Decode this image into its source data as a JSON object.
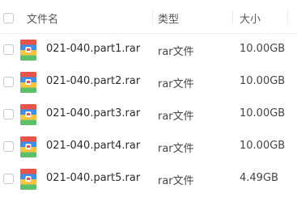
{
  "header": {
    "name_label": "文件名",
    "type_label": "类型",
    "size_label": "大小"
  },
  "files": [
    {
      "name": "021-040.part1.rar",
      "type": "rar文件",
      "size": "10.00GB",
      "icon": "rar-archive-icon"
    },
    {
      "name": "021-040.part2.rar",
      "type": "rar文件",
      "size": "10.00GB",
      "icon": "rar-archive-icon"
    },
    {
      "name": "021-040.part3.rar",
      "type": "rar文件",
      "size": "10.00GB",
      "icon": "rar-archive-icon"
    },
    {
      "name": "021-040.part4.rar",
      "type": "rar文件",
      "size": "10.00GB",
      "icon": "rar-archive-icon"
    },
    {
      "name": "021-040.part5.rar",
      "type": "rar文件",
      "size": "4.49GB",
      "icon": "rar-archive-icon"
    }
  ],
  "colors": {
    "icon_red": "#e8534a",
    "icon_blue": "#3e8ee8",
    "icon_yellow": "#f6c343",
    "icon_green": "#5cc06a"
  }
}
